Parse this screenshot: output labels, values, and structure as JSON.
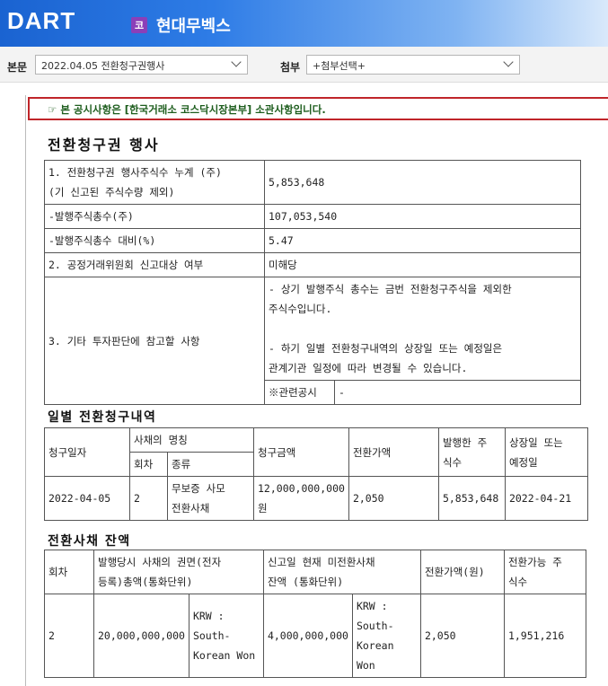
{
  "header": {
    "logo_text": "DART",
    "company_badge": "코",
    "company_name": "현대무벡스"
  },
  "toolbar": {
    "doc_label": "본문",
    "doc_select": "2022.04.05  전환청구권행사",
    "attach_label": "첨부",
    "attach_select": "+첨부선택+"
  },
  "notice": "☞ 본 공시사항은 [한국거래소 코스닥시장본부] 소관사항입니다.",
  "title": "전환청구권 행사",
  "summary": {
    "row1_label_a": "1. 전환청구권 행사주식수 누계 (주)",
    "row1_label_b": "(기 신고된 주식수량 제외)",
    "row1_value": "5,853,648",
    "row2_label": "-발행주식총수(주)",
    "row2_value": "107,053,540",
    "row3_label": "-발행주식총수 대비(%)",
    "row3_value": "5.47",
    "row4_label": "2. 공정거래위원회 신고대상 여부",
    "row4_value": "미해당",
    "row5_label": "3. 기타 투자판단에 참고할 사항",
    "row5_line1": "- 상기 발행주식 총수는 금번 전환청구주식을 제외한",
    "row5_line2": "주식수입니다.",
    "row5_line3": "- 하기 일별 전환청구내역의 상장일 또는 예정일은",
    "row5_line4": "관계기관 일정에 따라 변경될 수 있습니다.",
    "related_label": "※관련공시",
    "related_value": "-"
  },
  "daily": {
    "heading": "일별 전환청구내역",
    "headers": {
      "date": "청구일자",
      "bond_name": "사채의 명칭",
      "round": "회차",
      "kind": "종류",
      "amount": "청구금액",
      "price": "전환가액",
      "shares_a": "발행한 주",
      "shares_b": "식수",
      "listing_a": "상장일 또는",
      "listing_b": "예정일"
    },
    "row": {
      "date": "2022-04-05",
      "round": "2",
      "kind_a": "무보증 사모",
      "kind_b": "전환사채",
      "amount_a": "12,000,000,000",
      "amount_b": "원",
      "price": "2,050",
      "shares": "5,853,648",
      "listing": "2022-04-21"
    }
  },
  "balance": {
    "heading": "전환사채 잔액",
    "headers": {
      "round": "회차",
      "face_a": "발행당시 사채의 권면(전자",
      "face_b": "등록)총액(통화단위)",
      "remain_a": "신고일 현재 미전환사채",
      "remain_b": "잔액 (통화단위)",
      "price": "전환가액(원)",
      "convertible_a": "전환가능 주",
      "convertible_b": "식수"
    },
    "row": {
      "round": "2",
      "face_amount": "20,000,000,000",
      "face_cur_a": "KRW :",
      "face_cur_b": "South-",
      "face_cur_c": "Korean Won",
      "remain_amount": "4,000,000,000",
      "remain_cur_a": "KRW :",
      "remain_cur_b": "South-",
      "remain_cur_c": "Korean Won",
      "price": "2,050",
      "convertible": "1,951,216"
    }
  }
}
